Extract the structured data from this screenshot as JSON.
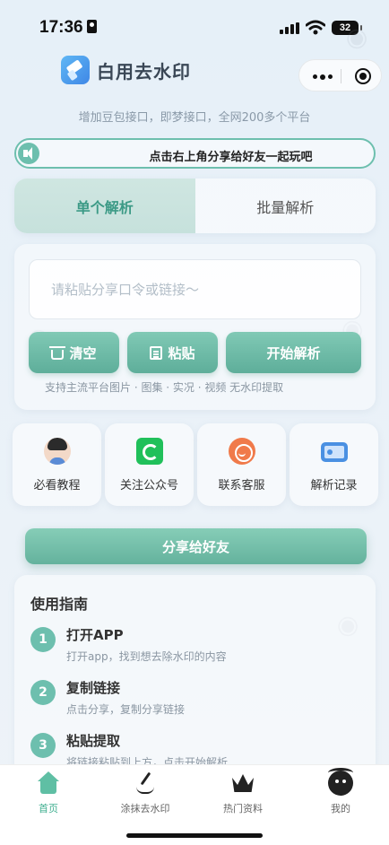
{
  "status_bar": {
    "time": "17:36",
    "battery": "32"
  },
  "header": {
    "app_title": "白用去水印"
  },
  "subtitle": "增加豆包接口，即梦接口，全网200多个平台",
  "notice": {
    "text": "点击右上角分享给好友一起玩吧"
  },
  "tabs": [
    {
      "label": "单个解析",
      "active": true
    },
    {
      "label": "批量解析",
      "active": false
    }
  ],
  "main": {
    "input": {
      "value": "",
      "placeholder": "请粘贴分享口令或链接～"
    },
    "buttons": {
      "clear": "清空",
      "paste": "粘贴",
      "start": "开始解析"
    },
    "hint": "支持主流平台图片 · 图集 · 实况 · 视频 无水印提取"
  },
  "quick_actions": [
    {
      "label": "必看教程",
      "icon": "avatar-icon"
    },
    {
      "label": "关注公众号",
      "icon": "wechat-icon"
    },
    {
      "label": "联系客服",
      "icon": "service-icon"
    },
    {
      "label": "解析记录",
      "icon": "record-icon"
    }
  ],
  "share_button": "分享给好友",
  "guide": {
    "title": "使用指南",
    "steps": [
      {
        "num": "1",
        "title": "打开APP",
        "desc": "打开app，找到想去除水印的内容"
      },
      {
        "num": "2",
        "title": "复制链接",
        "desc": "点击分享，复制分享链接"
      },
      {
        "num": "3",
        "title": "粘贴提取",
        "desc": "将链接粘贴到上方，点击开始解析"
      }
    ]
  },
  "nav": [
    {
      "label": "首页",
      "icon": "home-icon",
      "active": true
    },
    {
      "label": "涂抹去水印",
      "icon": "brush-icon",
      "active": false
    },
    {
      "label": "热门资料",
      "icon": "crown-icon",
      "active": false
    },
    {
      "label": "我的",
      "icon": "profile-icon",
      "active": false
    }
  ],
  "colors": {
    "accent": "#6dbfae",
    "accent_dark": "#3c9a86",
    "nav_active": "#3fae8f"
  }
}
